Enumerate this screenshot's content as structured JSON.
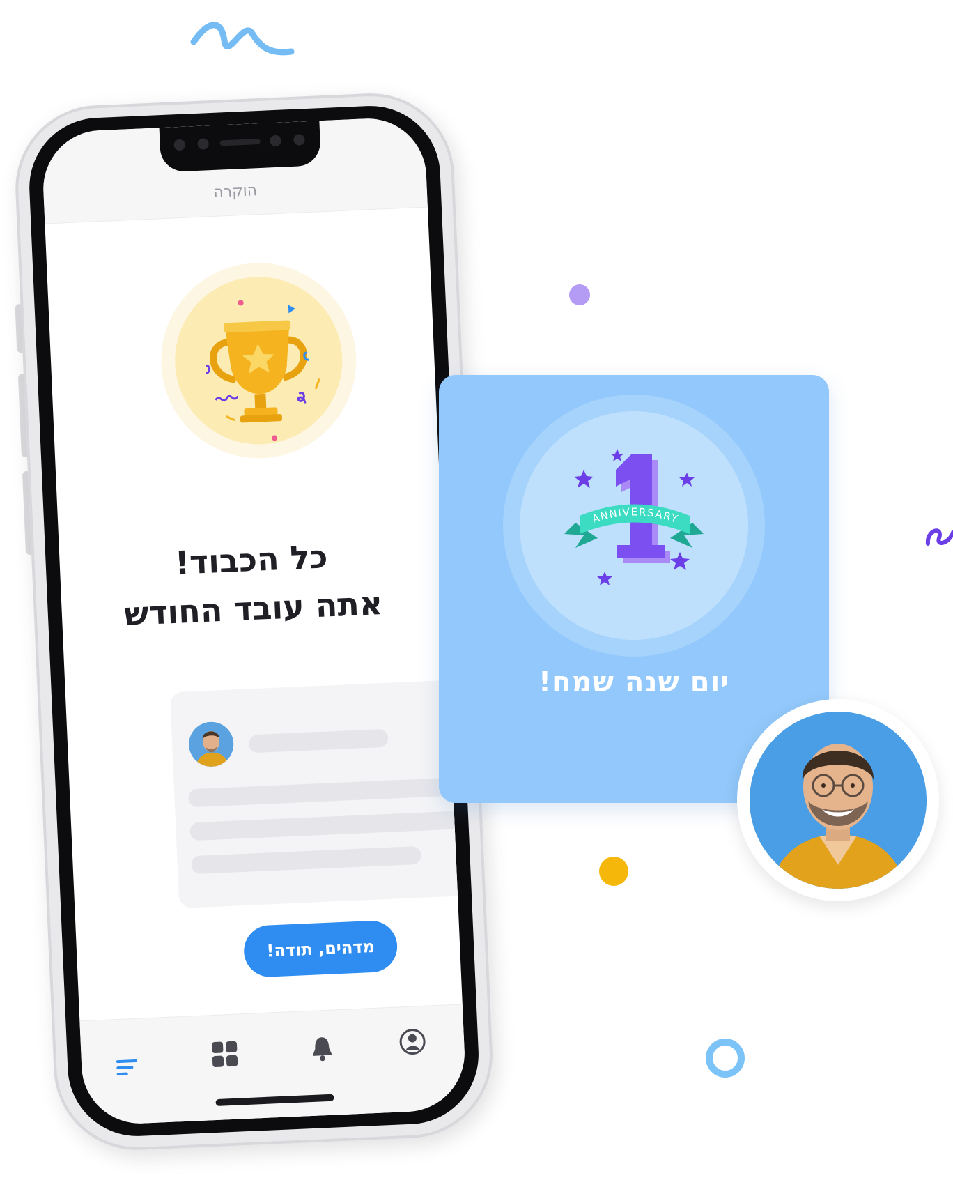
{
  "phone": {
    "screen_title": "הוקרה",
    "headline_line1": "כל הכבוד!",
    "headline_line2": "אתה עובד החודש",
    "cta_label": "מדהים, תודה!",
    "tabs": [
      {
        "icon": "list-icon",
        "active": true
      },
      {
        "icon": "grid-icon",
        "active": false
      },
      {
        "icon": "bell-icon",
        "active": false
      },
      {
        "icon": "profile-icon",
        "active": false
      }
    ]
  },
  "anniversary_card": {
    "badge_number": "1",
    "badge_ribbon": "ANNIVERSARY",
    "message": "יום שנה שמח!"
  },
  "colors": {
    "accent_blue": "#2f8cf0",
    "card_blue": "#92c8fb",
    "trophy_gold": "#f5b41f",
    "purple": "#6b3ee8",
    "teal": "#2fd1b8",
    "dot_purple": "#b49cf5",
    "dot_yellow": "#f5b80a",
    "ring_blue": "#7cc3f7"
  }
}
